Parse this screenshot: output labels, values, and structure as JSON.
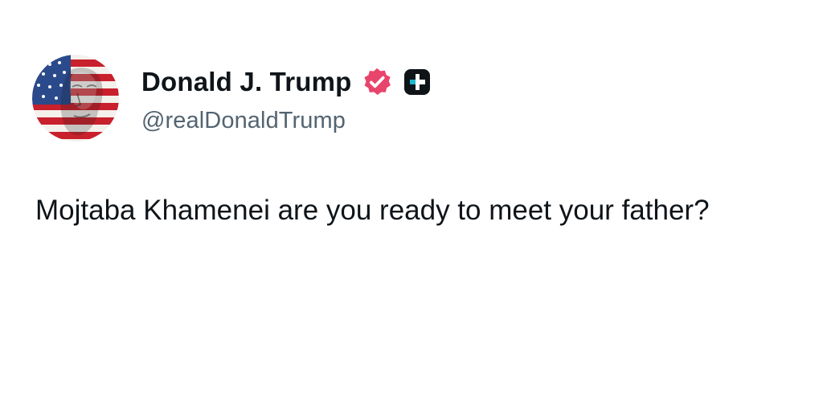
{
  "author": {
    "display_name": "Donald J. Trump",
    "handle": "@realDonaldTrump",
    "avatar_icon": "avatar-flag-portrait",
    "verified_icon": "verified-badge-icon",
    "affiliate_icon": "affiliate-badge-icon"
  },
  "post": {
    "text": "Mojtaba Khamenei are you ready to meet your father?"
  },
  "colors": {
    "background": "#ffffff",
    "name": "#0f1419",
    "handle": "#536471",
    "verified_badge": "#e8446c",
    "affiliate_badge": "#0f1419",
    "affiliate_accent": "#1db8c9"
  }
}
